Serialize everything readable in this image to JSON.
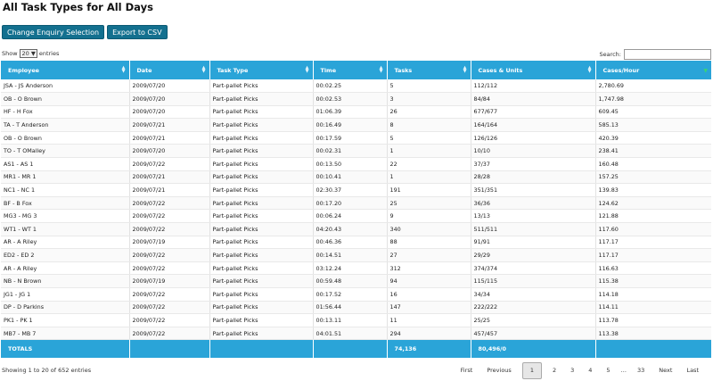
{
  "page": {
    "title": "All Task Types for All Days"
  },
  "toolbar": {
    "change_label": "Change Enquiry Selection",
    "export_label": "Export to CSV"
  },
  "length_menu": {
    "show": "Show",
    "value": "20",
    "entries": "entries"
  },
  "search": {
    "label": "Search:",
    "value": ""
  },
  "table": {
    "columns": [
      "Employee",
      "Date",
      "Task Type",
      "Time",
      "Tasks",
      "Cases & Units",
      "Cases/Hour"
    ],
    "sorted_column": "Cases/Hour",
    "rows": [
      [
        "JSA - JS Anderson",
        "2009/07/20",
        "Part-pallet Picks",
        "00:02.25",
        "5",
        "112/112",
        "2,780.69"
      ],
      [
        "OB - O Brown",
        "2009/07/20",
        "Part-pallet Picks",
        "00:02.53",
        "3",
        "84/84",
        "1,747.98"
      ],
      [
        "HF - H Fox",
        "2009/07/20",
        "Part-pallet Picks",
        "01:06.39",
        "26",
        "677/677",
        "609.45"
      ],
      [
        "TA - T Anderson",
        "2009/07/21",
        "Part-pallet Picks",
        "00:16.49",
        "8",
        "164/164",
        "585.13"
      ],
      [
        "OB - O Brown",
        "2009/07/21",
        "Part-pallet Picks",
        "00:17.59",
        "5",
        "126/126",
        "420.39"
      ],
      [
        "TO - T OMalley",
        "2009/07/20",
        "Part-pallet Picks",
        "00:02.31",
        "1",
        "10/10",
        "238.41"
      ],
      [
        "AS1 - AS 1",
        "2009/07/22",
        "Part-pallet Picks",
        "00:13.50",
        "22",
        "37/37",
        "160.48"
      ],
      [
        "MR1 - MR 1",
        "2009/07/21",
        "Part-pallet Picks",
        "00:10.41",
        "1",
        "28/28",
        "157.25"
      ],
      [
        "NC1 - NC 1",
        "2009/07/21",
        "Part-pallet Picks",
        "02:30.37",
        "191",
        "351/351",
        "139.83"
      ],
      [
        "BF - B Fox",
        "2009/07/22",
        "Part-pallet Picks",
        "00:17.20",
        "25",
        "36/36",
        "124.62"
      ],
      [
        "MG3 - MG 3",
        "2009/07/22",
        "Part-pallet Picks",
        "00:06.24",
        "9",
        "13/13",
        "121.88"
      ],
      [
        "WT1 - WT 1",
        "2009/07/22",
        "Part-pallet Picks",
        "04:20.43",
        "340",
        "511/511",
        "117.60"
      ],
      [
        "AR - A Riley",
        "2009/07/19",
        "Part-pallet Picks",
        "00:46.36",
        "88",
        "91/91",
        "117.17"
      ],
      [
        "ED2 - ED 2",
        "2009/07/22",
        "Part-pallet Picks",
        "00:14.51",
        "27",
        "29/29",
        "117.17"
      ],
      [
        "AR - A Riley",
        "2009/07/22",
        "Part-pallet Picks",
        "03:12.24",
        "312",
        "374/374",
        "116.63"
      ],
      [
        "NB - N Brown",
        "2009/07/19",
        "Part-pallet Picks",
        "00:59.48",
        "94",
        "115/115",
        "115.38"
      ],
      [
        "JG1 - JG 1",
        "2009/07/22",
        "Part-pallet Picks",
        "00:17.52",
        "16",
        "34/34",
        "114.18"
      ],
      [
        "DP - D Parkins",
        "2009/07/22",
        "Part-pallet Picks",
        "01:56.44",
        "147",
        "222/222",
        "114.11"
      ],
      [
        "PK1 - PK 1",
        "2009/07/22",
        "Part-pallet Picks",
        "00:13.11",
        "11",
        "25/25",
        "113.78"
      ],
      [
        "MB7 - MB 7",
        "2009/07/22",
        "Part-pallet Picks",
        "04:01.51",
        "294",
        "457/457",
        "113.38"
      ]
    ],
    "totals": [
      "TOTALS",
      "",
      "",
      "",
      "74,136",
      "80,496/0",
      ""
    ]
  },
  "info": "Showing 1 to 20 of 652 entries",
  "pagination": {
    "first": "First",
    "previous": "Previous",
    "pages": [
      "1",
      "2",
      "3",
      "4",
      "5"
    ],
    "current": "1",
    "ellipsis": "…",
    "last_page": "33",
    "next": "Next",
    "last": "Last"
  },
  "colors": {
    "header": "#2aa4d8",
    "button": "#13708f"
  }
}
